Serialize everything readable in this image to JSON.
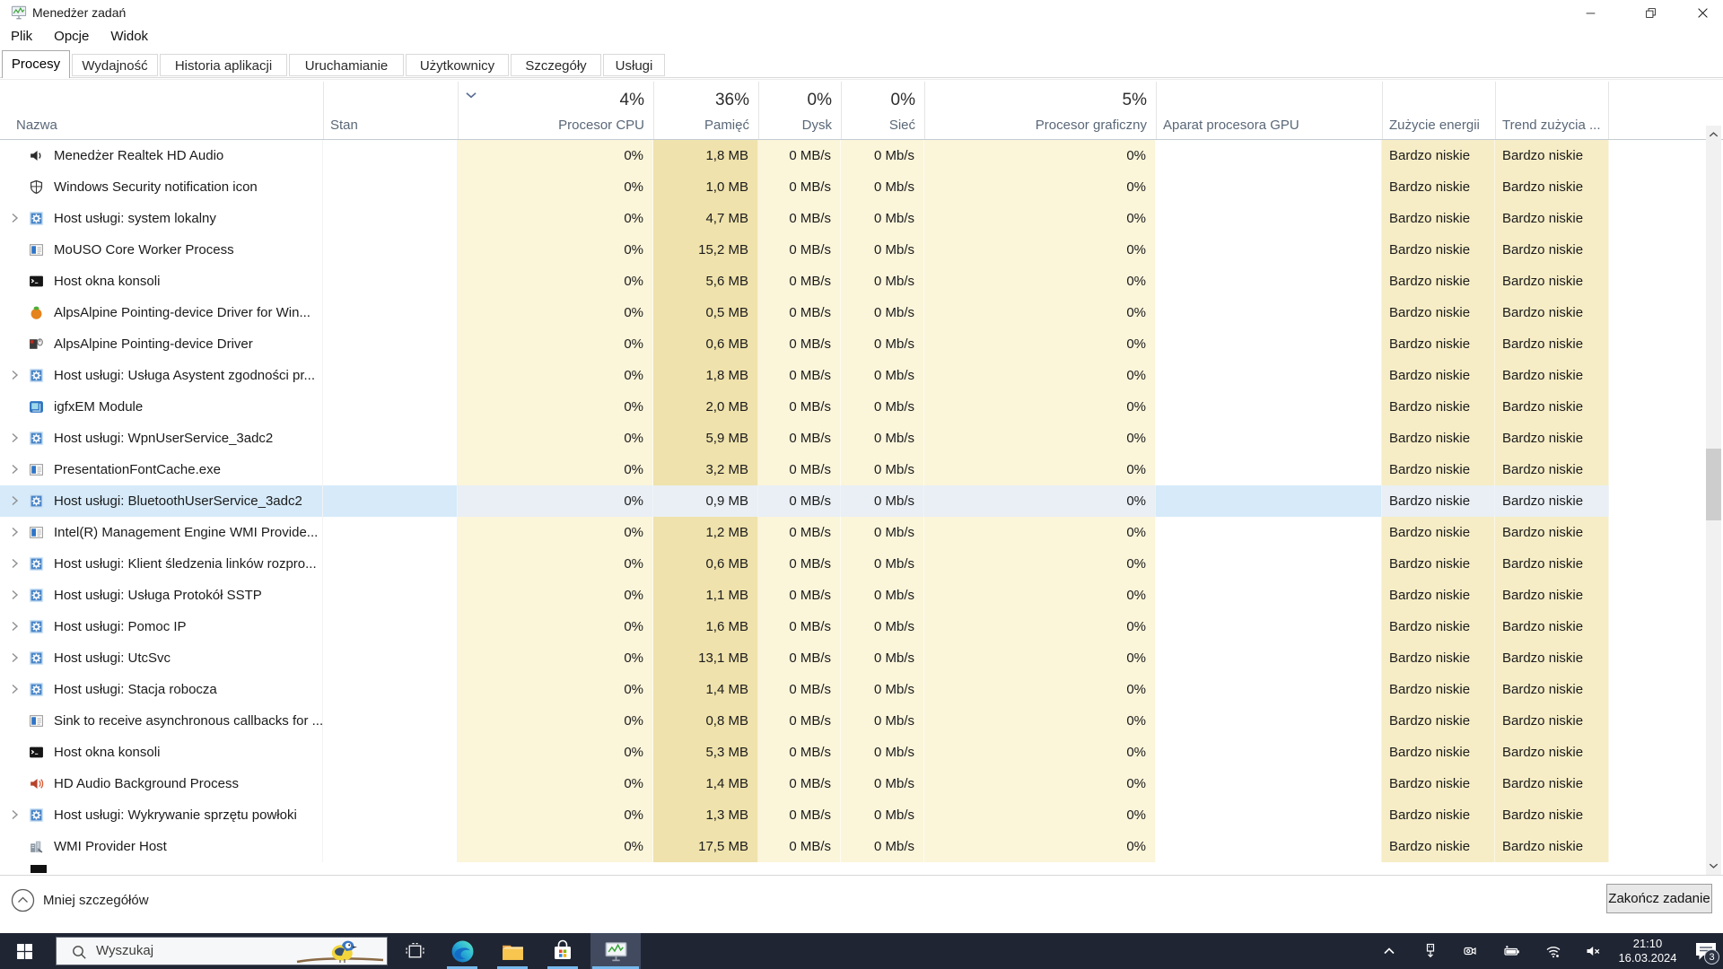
{
  "window": {
    "title": "Menedżer zadań",
    "controls": [
      {
        "name": "minimize-icon"
      },
      {
        "name": "restore-icon"
      },
      {
        "name": "close-icon"
      }
    ]
  },
  "menu_bar": {
    "items": [
      "Plik",
      "Opcje",
      "Widok"
    ]
  },
  "tabs": {
    "items": [
      {
        "label": "Procesy",
        "active": true
      },
      {
        "label": "Wydajność",
        "active": false
      },
      {
        "label": "Historia aplikacji",
        "active": false
      },
      {
        "label": "Uruchamianie",
        "active": false
      },
      {
        "label": "Użytkownicy",
        "active": false
      },
      {
        "label": "Szczegóły",
        "active": false
      },
      {
        "label": "Usługi",
        "active": false
      }
    ]
  },
  "process_table": {
    "sort": {
      "column": "cpu",
      "icon": "chevron-down-icon"
    },
    "columns": [
      {
        "id": "name",
        "label": "Nazwa",
        "summary": ""
      },
      {
        "id": "status",
        "label": "Stan",
        "summary": ""
      },
      {
        "id": "cpu",
        "label": "Procesor CPU",
        "summary": "4%"
      },
      {
        "id": "memory",
        "label": "Pamięć",
        "summary": "36%"
      },
      {
        "id": "disk",
        "label": "Dysk",
        "summary": "0%"
      },
      {
        "id": "network",
        "label": "Sieć",
        "summary": "0%"
      },
      {
        "id": "gpu",
        "label": "Procesor graficzny",
        "summary": "5%"
      },
      {
        "id": "gpu_engine",
        "label": "Aparat procesora GPU",
        "summary": ""
      },
      {
        "id": "power",
        "label": "Zużycie energii",
        "summary": ""
      },
      {
        "id": "power_trend",
        "label": "Trend zużycia ...",
        "summary": ""
      }
    ],
    "rows": [
      {
        "name": "Menedżer Realtek HD Audio",
        "icon": "speaker-dark-icon",
        "expandable": false,
        "selected": false,
        "status": "",
        "cpu": "0%",
        "memory": "1,8 MB",
        "disk": "0 MB/s",
        "network": "0 Mb/s",
        "gpu": "0%",
        "gpu_engine": "",
        "power": "Bardzo niskie",
        "power_trend": "Bardzo niskie"
      },
      {
        "name": "Windows Security notification icon",
        "icon": "shield-icon",
        "expandable": false,
        "selected": false,
        "status": "",
        "cpu": "0%",
        "memory": "1,0 MB",
        "disk": "0 MB/s",
        "network": "0 Mb/s",
        "gpu": "0%",
        "gpu_engine": "",
        "power": "Bardzo niskie",
        "power_trend": "Bardzo niskie"
      },
      {
        "name": "Host usługi: system lokalny",
        "icon": "service-gear-icon",
        "expandable": true,
        "selected": false,
        "status": "",
        "cpu": "0%",
        "memory": "4,7 MB",
        "disk": "0 MB/s",
        "network": "0 Mb/s",
        "gpu": "0%",
        "gpu_engine": "",
        "power": "Bardzo niskie",
        "power_trend": "Bardzo niskie"
      },
      {
        "name": "MoUSO Core Worker Process",
        "icon": "app-window-icon",
        "expandable": false,
        "selected": false,
        "status": "",
        "cpu": "0%",
        "memory": "15,2 MB",
        "disk": "0 MB/s",
        "network": "0 Mb/s",
        "gpu": "0%",
        "gpu_engine": "",
        "power": "Bardzo niskie",
        "power_trend": "Bardzo niskie"
      },
      {
        "name": "Host okna konsoli",
        "icon": "console-icon",
        "expandable": false,
        "selected": false,
        "status": "",
        "cpu": "0%",
        "memory": "5,6 MB",
        "disk": "0 MB/s",
        "network": "0 Mb/s",
        "gpu": "0%",
        "gpu_engine": "",
        "power": "Bardzo niskie",
        "power_trend": "Bardzo niskie"
      },
      {
        "name": "AlpsAlpine Pointing-device Driver for Win...",
        "icon": "alps-ball-icon",
        "expandable": false,
        "selected": false,
        "status": "",
        "cpu": "0%",
        "memory": "0,5 MB",
        "disk": "0 MB/s",
        "network": "0 Mb/s",
        "gpu": "0%",
        "gpu_engine": "",
        "power": "Bardzo niskie",
        "power_trend": "Bardzo niskie"
      },
      {
        "name": "AlpsAlpine Pointing-device Driver",
        "icon": "alps-mouse-icon",
        "expandable": false,
        "selected": false,
        "status": "",
        "cpu": "0%",
        "memory": "0,6 MB",
        "disk": "0 MB/s",
        "network": "0 Mb/s",
        "gpu": "0%",
        "gpu_engine": "",
        "power": "Bardzo niskie",
        "power_trend": "Bardzo niskie"
      },
      {
        "name": "Host usługi: Usługa Asystent zgodności pr...",
        "icon": "service-gear-icon",
        "expandable": true,
        "selected": false,
        "status": "",
        "cpu": "0%",
        "memory": "1,8 MB",
        "disk": "0 MB/s",
        "network": "0 Mb/s",
        "gpu": "0%",
        "gpu_engine": "",
        "power": "Bardzo niskie",
        "power_trend": "Bardzo niskie"
      },
      {
        "name": "igfxEM Module",
        "icon": "igfx-icon",
        "expandable": false,
        "selected": false,
        "status": "",
        "cpu": "0%",
        "memory": "2,0 MB",
        "disk": "0 MB/s",
        "network": "0 Mb/s",
        "gpu": "0%",
        "gpu_engine": "",
        "power": "Bardzo niskie",
        "power_trend": "Bardzo niskie"
      },
      {
        "name": "Host usługi: WpnUserService_3adc2",
        "icon": "service-gear-icon",
        "expandable": true,
        "selected": false,
        "status": "",
        "cpu": "0%",
        "memory": "5,9 MB",
        "disk": "0 MB/s",
        "network": "0 Mb/s",
        "gpu": "0%",
        "gpu_engine": "",
        "power": "Bardzo niskie",
        "power_trend": "Bardzo niskie"
      },
      {
        "name": "PresentationFontCache.exe",
        "icon": "app-window-icon",
        "expandable": true,
        "selected": false,
        "status": "",
        "cpu": "0%",
        "memory": "3,2 MB",
        "disk": "0 MB/s",
        "network": "0 Mb/s",
        "gpu": "0%",
        "gpu_engine": "",
        "power": "Bardzo niskie",
        "power_trend": "Bardzo niskie"
      },
      {
        "name": "Host usługi: BluetoothUserService_3adc2",
        "icon": "service-gear-icon",
        "expandable": true,
        "selected": true,
        "status": "",
        "cpu": "0%",
        "memory": "0,9 MB",
        "disk": "0 MB/s",
        "network": "0 Mb/s",
        "gpu": "0%",
        "gpu_engine": "",
        "power": "Bardzo niskie",
        "power_trend": "Bardzo niskie"
      },
      {
        "name": "Intel(R) Management Engine WMI Provide...",
        "icon": "app-window-icon",
        "expandable": true,
        "selected": false,
        "status": "",
        "cpu": "0%",
        "memory": "1,2 MB",
        "disk": "0 MB/s",
        "network": "0 Mb/s",
        "gpu": "0%",
        "gpu_engine": "",
        "power": "Bardzo niskie",
        "power_trend": "Bardzo niskie"
      },
      {
        "name": "Host usługi: Klient śledzenia linków rozpro...",
        "icon": "service-gear-icon",
        "expandable": true,
        "selected": false,
        "status": "",
        "cpu": "0%",
        "memory": "0,6 MB",
        "disk": "0 MB/s",
        "network": "0 Mb/s",
        "gpu": "0%",
        "gpu_engine": "",
        "power": "Bardzo niskie",
        "power_trend": "Bardzo niskie"
      },
      {
        "name": "Host usługi: Usługa Protokół SSTP",
        "icon": "service-gear-icon",
        "expandable": true,
        "selected": false,
        "status": "",
        "cpu": "0%",
        "memory": "1,1 MB",
        "disk": "0 MB/s",
        "network": "0 Mb/s",
        "gpu": "0%",
        "gpu_engine": "",
        "power": "Bardzo niskie",
        "power_trend": "Bardzo niskie"
      },
      {
        "name": "Host usługi: Pomoc IP",
        "icon": "service-gear-icon",
        "expandable": true,
        "selected": false,
        "status": "",
        "cpu": "0%",
        "memory": "1,6 MB",
        "disk": "0 MB/s",
        "network": "0 Mb/s",
        "gpu": "0%",
        "gpu_engine": "",
        "power": "Bardzo niskie",
        "power_trend": "Bardzo niskie"
      },
      {
        "name": "Host usługi: UtcSvc",
        "icon": "service-gear-icon",
        "expandable": true,
        "selected": false,
        "status": "",
        "cpu": "0%",
        "memory": "13,1 MB",
        "disk": "0 MB/s",
        "network": "0 Mb/s",
        "gpu": "0%",
        "gpu_engine": "",
        "power": "Bardzo niskie",
        "power_trend": "Bardzo niskie"
      },
      {
        "name": "Host usługi: Stacja robocza",
        "icon": "service-gear-icon",
        "expandable": true,
        "selected": false,
        "status": "",
        "cpu": "0%",
        "memory": "1,4 MB",
        "disk": "0 MB/s",
        "network": "0 Mb/s",
        "gpu": "0%",
        "gpu_engine": "",
        "power": "Bardzo niskie",
        "power_trend": "Bardzo niskie"
      },
      {
        "name": "Sink to receive asynchronous callbacks for ...",
        "icon": "app-window-icon",
        "expandable": false,
        "selected": false,
        "status": "",
        "cpu": "0%",
        "memory": "0,8 MB",
        "disk": "0 MB/s",
        "network": "0 Mb/s",
        "gpu": "0%",
        "gpu_engine": "",
        "power": "Bardzo niskie",
        "power_trend": "Bardzo niskie"
      },
      {
        "name": "Host okna konsoli",
        "icon": "console-icon",
        "expandable": false,
        "selected": false,
        "status": "",
        "cpu": "0%",
        "memory": "5,3 MB",
        "disk": "0 MB/s",
        "network": "0 Mb/s",
        "gpu": "0%",
        "gpu_engine": "",
        "power": "Bardzo niskie",
        "power_trend": "Bardzo niskie"
      },
      {
        "name": "HD Audio Background Process",
        "icon": "hd-audio-icon",
        "expandable": false,
        "selected": false,
        "status": "",
        "cpu": "0%",
        "memory": "1,4 MB",
        "disk": "0 MB/s",
        "network": "0 Mb/s",
        "gpu": "0%",
        "gpu_engine": "",
        "power": "Bardzo niskie",
        "power_trend": "Bardzo niskie"
      },
      {
        "name": "Host usługi: Wykrywanie sprzętu powłoki",
        "icon": "service-gear-icon",
        "expandable": true,
        "selected": false,
        "status": "",
        "cpu": "0%",
        "memory": "1,3 MB",
        "disk": "0 MB/s",
        "network": "0 Mb/s",
        "gpu": "0%",
        "gpu_engine": "",
        "power": "Bardzo niskie",
        "power_trend": "Bardzo niskie"
      },
      {
        "name": "WMI Provider Host",
        "icon": "wmi-icon",
        "expandable": false,
        "selected": false,
        "status": "",
        "cpu": "0%",
        "memory": "17,5 MB",
        "disk": "0 MB/s",
        "network": "0 Mb/s",
        "gpu": "0%",
        "gpu_engine": "",
        "power": "Bardzo niskie",
        "power_trend": "Bardzo niskie"
      }
    ]
  },
  "footer": {
    "less_details_label": "Mniej szczegółów",
    "less_details_icon": "circle-chevron-up-icon",
    "end_task_label": "Zakończ zadanie"
  },
  "taskbar": {
    "search": {
      "placeholder": "Wyszukaj",
      "icon": "search-icon",
      "artwork_icon": "bird-artwork-icon"
    },
    "buttons": [
      {
        "icon": "start-icon",
        "running": false,
        "active": false
      },
      {
        "icon": "task-view-icon",
        "running": false,
        "active": false
      },
      {
        "icon": "edge-icon",
        "running": true,
        "active": false
      },
      {
        "icon": "file-explorer-icon",
        "running": true,
        "active": false
      },
      {
        "icon": "store-icon",
        "running": true,
        "active": false
      },
      {
        "icon": "task-manager-icon",
        "running": true,
        "active": true
      }
    ],
    "tray": {
      "icons": [
        "chevron-up-icon",
        "usb-icon",
        "camera-icon",
        "battery-icon",
        "wifi-icon",
        "volume-muted-icon"
      ],
      "clock": {
        "time": "21:10",
        "date": "16.03.2024"
      },
      "notifications": {
        "icon": "notification-icon",
        "badge": "3"
      }
    }
  },
  "colors": {
    "selection": "#d6eaf9",
    "heat_light": "#fbf5da",
    "heat_dark": "#efe2ac",
    "heat_mid": "#f6edc6",
    "taskbar_bg": "#1f2533",
    "running_underline": "#76b9ed"
  }
}
